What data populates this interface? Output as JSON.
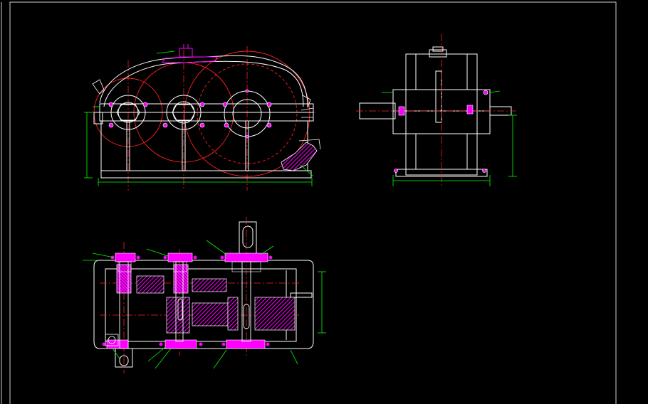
{
  "drawing": {
    "background": "#000000",
    "colors": {
      "outline": "#ffffff",
      "center": "#ff2020",
      "hatch": "#ff00ff",
      "dimension": "#00ff00",
      "frame": "#cfcfcf"
    },
    "views": [
      "front-view",
      "side-view",
      "top-section-view"
    ]
  }
}
